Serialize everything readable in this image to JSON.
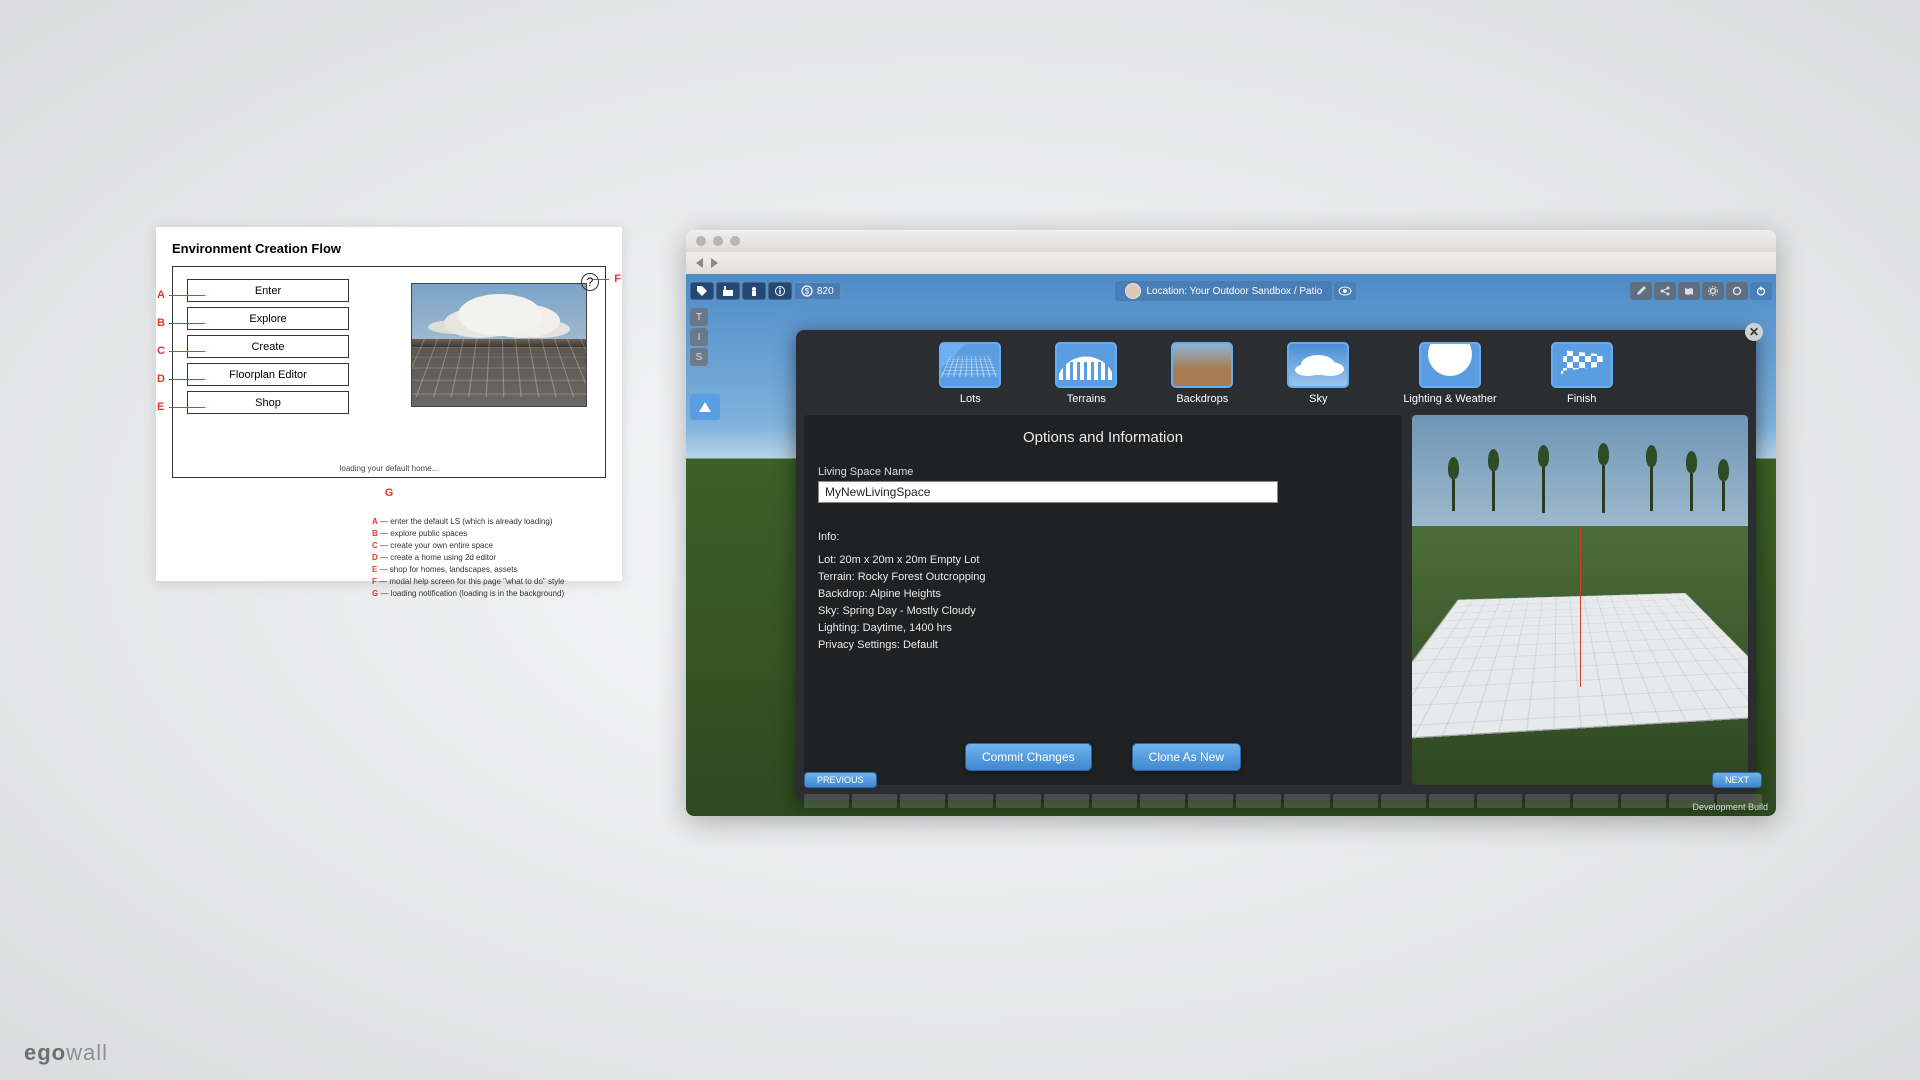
{
  "logo": {
    "bold": "ego",
    "rest": "wall"
  },
  "wireframe": {
    "title": "Environment Creation Flow",
    "menu": [
      "Enter",
      "Explore",
      "Create",
      "Floorplan Editor",
      "Shop"
    ],
    "help": "?",
    "loading": "loading your default home...",
    "markers": {
      "a": "A",
      "b": "B",
      "c": "C",
      "d": "D",
      "e": "E",
      "f": "F",
      "g": "G"
    },
    "legend": [
      {
        "k": "A",
        "t": "enter the default LS (which is already loading)"
      },
      {
        "k": "B",
        "t": "explore public spaces"
      },
      {
        "k": "C",
        "t": "create your own entire space"
      },
      {
        "k": "D",
        "t": "create a home using 2d editor"
      },
      {
        "k": "E",
        "t": "shop for homes, landscapes, assets"
      },
      {
        "k": "F",
        "t": "modal help screen for this page \"what to do\" style"
      },
      {
        "k": "G",
        "t": "loading notification (loading is in the background)"
      }
    ]
  },
  "app": {
    "currency": "820",
    "location_label": "Location: Your Outdoor Sandbox / Patio",
    "side_buttons": [
      "T",
      "I",
      "S"
    ],
    "modal": {
      "tabs": [
        "Lots",
        "Terrains",
        "Backdrops",
        "Sky",
        "Lighting & Weather",
        "Finish"
      ],
      "panel_title": "Options and Information",
      "name_label": "Living Space Name",
      "name_value": "MyNewLivingSpace",
      "info_label": "Info:",
      "info_lines": [
        "Lot: 20m x 20m x 20m Empty Lot",
        "Terrain: Rocky Forest Outcropping",
        "Backdrop: Alpine Heights",
        "Sky: Spring Day - Mostly Cloudy",
        "Lighting: Daytime, 1400 hrs",
        "Privacy Settings: Default"
      ],
      "btn_commit": "Commit Changes",
      "btn_clone": "Clone As New",
      "btn_prev": "PREVIOUS",
      "btn_next": "NEXT"
    },
    "dev_label": "Development Build"
  }
}
